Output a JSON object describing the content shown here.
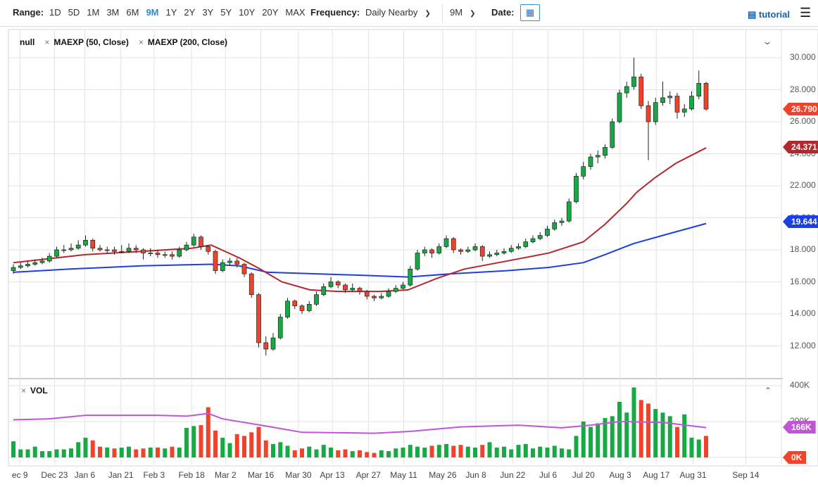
{
  "toolbar": {
    "range_label": "Range:",
    "ranges": [
      "1D",
      "5D",
      "1M",
      "3M",
      "6M",
      "9M",
      "1Y",
      "2Y",
      "3Y",
      "5Y",
      "10Y",
      "20Y",
      "MAX"
    ],
    "active_range": "9M",
    "frequency_label": "Frequency:",
    "frequency_value": "Daily Nearby",
    "period_value": "9M",
    "date_label": "Date:",
    "calendar_icon": "calendar-icon",
    "tutorial_label": "tutorial",
    "menu_icon": "hamburger-icon"
  },
  "legend": {
    "main": "null",
    "study1": "MAEXP (50, Close)",
    "study2": "MAEXP (200, Close)",
    "close_icon": "×",
    "vol": "VOL"
  },
  "colors": {
    "up": "#17a943",
    "down": "#f0432a",
    "ma50": "#b3282d",
    "ma200": "#1b3fe0",
    "vol_avg": "#c055d6",
    "last_price": "#f0432a",
    "grid": "#e3e3e3"
  },
  "chart_data": {
    "type": "candlestick",
    "price_axis": {
      "ylim": [
        10,
        31
      ],
      "ticks": [
        "30.000",
        "28.000",
        "26.000",
        "24.000",
        "22.000",
        "20.000",
        "18.000",
        "16.000",
        "14.000",
        "12.000"
      ]
    },
    "x_ticks": [
      {
        "label": "ec 9",
        "i": 0.9
      },
      {
        "label": "Dec 23",
        "i": 5.7
      },
      {
        "label": "Jan 6",
        "i": 9.9
      },
      {
        "label": "Jan 21",
        "i": 14.9
      },
      {
        "label": "Feb 3",
        "i": 19.5
      },
      {
        "label": "Feb 18",
        "i": 24.7
      },
      {
        "label": "Mar 2",
        "i": 29.4
      },
      {
        "label": "Mar 16",
        "i": 34.3
      },
      {
        "label": "Mar 30",
        "i": 39.5
      },
      {
        "label": "Apr 13",
        "i": 44.2
      },
      {
        "label": "Apr 27",
        "i": 49.2
      },
      {
        "label": "May 11",
        "i": 54.1
      },
      {
        "label": "May 26",
        "i": 59.5
      },
      {
        "label": "Jun 8",
        "i": 64.1
      },
      {
        "label": "Jun 22",
        "i": 69.2
      },
      {
        "label": "Jul 6",
        "i": 74.1
      },
      {
        "label": "Jul 20",
        "i": 79
      },
      {
        "label": "Aug 3",
        "i": 84.1
      },
      {
        "label": "Aug 17",
        "i": 89.1
      },
      {
        "label": "Aug 31",
        "i": 94.2
      },
      {
        "label": "Sep 14",
        "i": 101.5
      }
    ],
    "xlim": [
      0,
      106.4
    ],
    "ohlc": [
      [
        16.7,
        17.1,
        16.5,
        16.9
      ],
      [
        16.9,
        17.2,
        16.8,
        17.0
      ],
      [
        17.0,
        17.3,
        16.9,
        17.1
      ],
      [
        17.1,
        17.4,
        17.0,
        17.2
      ],
      [
        17.2,
        17.5,
        17.1,
        17.3
      ],
      [
        17.3,
        17.8,
        17.2,
        17.6
      ],
      [
        17.6,
        18.2,
        17.5,
        18.0
      ],
      [
        18.0,
        18.3,
        17.8,
        18.0
      ],
      [
        18.0,
        18.4,
        17.9,
        18.1
      ],
      [
        18.1,
        18.6,
        18.0,
        18.3
      ],
      [
        18.3,
        18.9,
        18.2,
        18.6
      ],
      [
        18.6,
        18.7,
        17.9,
        18.1
      ],
      [
        18.1,
        18.3,
        17.9,
        18.0
      ],
      [
        18.0,
        18.2,
        17.8,
        18.0
      ],
      [
        18.0,
        18.2,
        17.7,
        17.9
      ],
      [
        17.9,
        18.3,
        17.8,
        17.9
      ],
      [
        17.9,
        18.4,
        17.8,
        18.1
      ],
      [
        18.1,
        18.3,
        17.8,
        18.0
      ],
      [
        18.0,
        18.1,
        17.4,
        17.8
      ],
      [
        17.8,
        18.1,
        17.6,
        17.8
      ],
      [
        17.8,
        18.0,
        17.5,
        17.7
      ],
      [
        17.7,
        17.9,
        17.5,
        17.7
      ],
      [
        17.7,
        17.9,
        17.4,
        17.6
      ],
      [
        17.6,
        18.2,
        17.5,
        18.0
      ],
      [
        18.0,
        18.5,
        17.9,
        18.3
      ],
      [
        18.3,
        19.0,
        18.2,
        18.8
      ],
      [
        18.8,
        18.9,
        18.0,
        18.2
      ],
      [
        18.2,
        18.3,
        17.7,
        17.9
      ],
      [
        17.9,
        18.0,
        16.5,
        16.7
      ],
      [
        16.7,
        17.4,
        16.6,
        17.2
      ],
      [
        17.2,
        17.5,
        17.0,
        17.3
      ],
      [
        17.3,
        17.5,
        16.9,
        17.1
      ],
      [
        17.1,
        17.2,
        16.3,
        16.5
      ],
      [
        16.5,
        16.6,
        15.0,
        15.2
      ],
      [
        15.2,
        15.3,
        11.9,
        12.2
      ],
      [
        12.2,
        12.6,
        11.4,
        11.8
      ],
      [
        11.8,
        12.8,
        11.7,
        12.5
      ],
      [
        12.5,
        14.0,
        12.4,
        13.8
      ],
      [
        13.8,
        15.0,
        13.7,
        14.8
      ],
      [
        14.8,
        14.9,
        14.3,
        14.5
      ],
      [
        14.5,
        14.6,
        14.0,
        14.2
      ],
      [
        14.2,
        14.8,
        14.1,
        14.6
      ],
      [
        14.6,
        15.4,
        14.5,
        15.2
      ],
      [
        15.2,
        15.9,
        15.1,
        15.7
      ],
      [
        15.7,
        16.3,
        15.6,
        16.0
      ],
      [
        16.0,
        16.1,
        15.6,
        15.8
      ],
      [
        15.8,
        15.9,
        15.3,
        15.5
      ],
      [
        15.5,
        15.9,
        15.4,
        15.6
      ],
      [
        15.6,
        15.7,
        15.2,
        15.4
      ],
      [
        15.4,
        15.5,
        14.9,
        15.1
      ],
      [
        15.1,
        15.2,
        14.8,
        15.0
      ],
      [
        15.0,
        15.3,
        14.9,
        15.1
      ],
      [
        15.1,
        15.6,
        15.0,
        15.4
      ],
      [
        15.4,
        15.8,
        15.3,
        15.6
      ],
      [
        15.6,
        16.0,
        15.5,
        15.8
      ],
      [
        15.8,
        17.0,
        15.7,
        16.8
      ],
      [
        16.8,
        18.0,
        16.7,
        17.8
      ],
      [
        17.8,
        18.2,
        17.6,
        18.0
      ],
      [
        18.0,
        18.1,
        17.5,
        17.8
      ],
      [
        17.8,
        18.4,
        17.7,
        18.2
      ],
      [
        18.2,
        18.9,
        18.1,
        18.7
      ],
      [
        18.7,
        18.8,
        17.8,
        18.0
      ],
      [
        18.0,
        18.1,
        17.7,
        17.9
      ],
      [
        17.9,
        18.2,
        17.8,
        18.0
      ],
      [
        18.0,
        18.4,
        17.9,
        18.2
      ],
      [
        18.2,
        18.3,
        17.3,
        17.6
      ],
      [
        17.6,
        17.9,
        17.5,
        17.7
      ],
      [
        17.7,
        18.0,
        17.6,
        17.8
      ],
      [
        17.8,
        18.1,
        17.7,
        17.9
      ],
      [
        17.9,
        18.3,
        17.8,
        18.1
      ],
      [
        18.1,
        18.4,
        18.0,
        18.2
      ],
      [
        18.2,
        18.7,
        18.1,
        18.5
      ],
      [
        18.5,
        18.9,
        18.4,
        18.7
      ],
      [
        18.7,
        19.1,
        18.6,
        18.9
      ],
      [
        18.9,
        19.5,
        18.8,
        19.3
      ],
      [
        19.3,
        19.9,
        19.2,
        19.7
      ],
      [
        19.7,
        20.0,
        19.5,
        19.8
      ],
      [
        19.8,
        21.2,
        19.7,
        21.0
      ],
      [
        21.0,
        22.8,
        20.9,
        22.6
      ],
      [
        22.6,
        23.5,
        22.4,
        23.2
      ],
      [
        23.2,
        24.0,
        23.0,
        23.8
      ],
      [
        23.8,
        24.2,
        23.4,
        23.9
      ],
      [
        23.9,
        24.6,
        23.7,
        24.4
      ],
      [
        24.4,
        26.2,
        24.3,
        26.0
      ],
      [
        26.0,
        28.0,
        25.9,
        27.8
      ],
      [
        27.8,
        28.5,
        27.5,
        28.2
      ],
      [
        28.2,
        30.0,
        28.0,
        28.8
      ],
      [
        28.8,
        29.0,
        26.8,
        27.0
      ],
      [
        27.0,
        27.3,
        23.6,
        26.0
      ],
      [
        26.0,
        27.5,
        25.8,
        27.2
      ],
      [
        27.2,
        28.5,
        27.0,
        27.5
      ],
      [
        27.5,
        27.9,
        27.1,
        27.6
      ],
      [
        27.6,
        27.8,
        26.2,
        26.6
      ],
      [
        26.6,
        27.1,
        26.3,
        26.8
      ],
      [
        26.8,
        27.9,
        26.7,
        27.6
      ],
      [
        27.6,
        29.2,
        27.4,
        28.4
      ],
      [
        28.4,
        28.5,
        26.7,
        26.79
      ]
    ],
    "ma50": [
      [
        0,
        17.2
      ],
      [
        9.9,
        17.7
      ],
      [
        17.7,
        17.9
      ],
      [
        24.7,
        18.1
      ],
      [
        27.4,
        18.3
      ],
      [
        31.3,
        17.5
      ],
      [
        34.2,
        16.8
      ],
      [
        37.2,
        16.0
      ],
      [
        41.1,
        15.5
      ],
      [
        45,
        15.4
      ],
      [
        50.8,
        15.4
      ],
      [
        54.7,
        15.5
      ],
      [
        58.6,
        16.2
      ],
      [
        62.5,
        16.8
      ],
      [
        68.4,
        17.3
      ],
      [
        74.2,
        17.8
      ],
      [
        79,
        18.5
      ],
      [
        82,
        19.6
      ],
      [
        85,
        20.9
      ],
      [
        86.4,
        21.6
      ],
      [
        88.9,
        22.5
      ],
      [
        91.8,
        23.4
      ],
      [
        96,
        24.371
      ]
    ],
    "ma200": [
      [
        0,
        16.6
      ],
      [
        7.9,
        16.8
      ],
      [
        17.7,
        17.0
      ],
      [
        27.4,
        17.1
      ],
      [
        31.3,
        17.0
      ],
      [
        35.2,
        16.6
      ],
      [
        42,
        16.5
      ],
      [
        48.9,
        16.4
      ],
      [
        54.7,
        16.3
      ],
      [
        60.6,
        16.5
      ],
      [
        68.4,
        16.7
      ],
      [
        74.2,
        16.9
      ],
      [
        79,
        17.2
      ],
      [
        82,
        17.7
      ],
      [
        86,
        18.4
      ],
      [
        90.8,
        19.0
      ],
      [
        96,
        19.644
      ]
    ],
    "last": {
      "price": "26.790",
      "ma50": "24.371",
      "ma200": "19.644"
    },
    "volume_axis": {
      "ylim": [
        0,
        400
      ],
      "ticks": [
        "400K",
        "200K"
      ]
    },
    "volume": [
      90,
      45,
      45,
      60,
      35,
      35,
      45,
      45,
      50,
      85,
      110,
      95,
      60,
      55,
      50,
      55,
      60,
      45,
      50,
      55,
      55,
      50,
      60,
      55,
      165,
      175,
      180,
      280,
      150,
      110,
      80,
      130,
      120,
      140,
      170,
      95,
      75,
      85,
      65,
      40,
      50,
      60,
      45,
      70,
      55,
      40,
      45,
      35,
      40,
      30,
      25,
      40,
      35,
      50,
      55,
      70,
      60,
      55,
      65,
      70,
      75,
      65,
      70,
      60,
      55,
      70,
      85,
      55,
      60,
      45,
      70,
      75,
      50,
      60,
      55,
      65,
      50,
      45,
      120,
      200,
      170,
      190,
      220,
      230,
      310,
      250,
      390,
      320,
      300,
      270,
      250,
      230,
      170,
      240,
      110,
      100,
      120
    ],
    "vol_avg": [
      [
        0,
        210
      ],
      [
        5,
        215
      ],
      [
        10,
        235
      ],
      [
        20,
        235
      ],
      [
        24,
        230
      ],
      [
        27,
        245
      ],
      [
        29,
        215
      ],
      [
        35,
        175
      ],
      [
        40,
        140
      ],
      [
        50,
        135
      ],
      [
        55,
        145
      ],
      [
        62,
        170
      ],
      [
        70,
        180
      ],
      [
        76,
        165
      ],
      [
        80,
        180
      ],
      [
        84,
        200
      ],
      [
        90,
        195
      ],
      [
        96,
        166
      ]
    ],
    "vol_last": {
      "avg": "166K",
      "vol": "0K"
    }
  }
}
